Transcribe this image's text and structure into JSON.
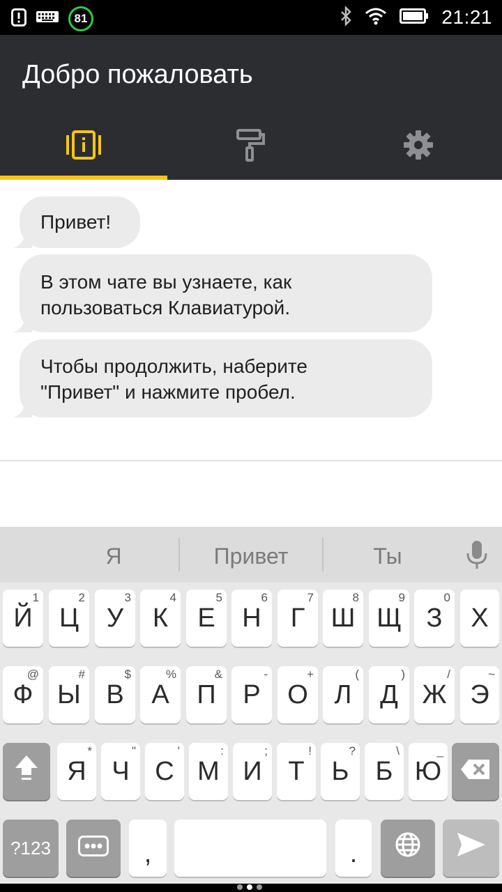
{
  "status_bar": {
    "time": "21:21",
    "badge": "81",
    "icons": [
      "alert-icon",
      "keyboard-icon",
      "bluetooth-icon",
      "wifi-icon",
      "battery-icon"
    ]
  },
  "app": {
    "title": "Добро пожаловать",
    "tabs": [
      {
        "name": "tab-info",
        "icon": "info-icon",
        "active": true
      },
      {
        "name": "tab-themes",
        "icon": "paint-roller-icon",
        "active": false
      },
      {
        "name": "tab-settings",
        "icon": "gear-icon",
        "active": false
      }
    ],
    "accent": "#f5c518"
  },
  "chat": {
    "messages": [
      {
        "line1": "Привет!",
        "line2": ""
      },
      {
        "line1": "В этом чате вы узнаете, как",
        "line2": "пользоваться Клавиатурой."
      },
      {
        "line1": "Чтобы продолжить, наберите",
        "line2": "\"Привет\" и нажмите пробел."
      }
    ]
  },
  "keyboard": {
    "suggestions": [
      "Я",
      "Привет",
      "Ты"
    ],
    "row1": [
      {
        "key": "Й",
        "hint": "1"
      },
      {
        "key": "Ц",
        "hint": "2"
      },
      {
        "key": "У",
        "hint": "3"
      },
      {
        "key": "К",
        "hint": "4"
      },
      {
        "key": "Е",
        "hint": "5"
      },
      {
        "key": "Н",
        "hint": "6"
      },
      {
        "key": "Г",
        "hint": "7"
      },
      {
        "key": "Ш",
        "hint": "8"
      },
      {
        "key": "Щ",
        "hint": "9"
      },
      {
        "key": "З",
        "hint": "0"
      },
      {
        "key": "Х",
        "hint": ""
      }
    ],
    "row2": [
      {
        "key": "Ф",
        "hint": "@"
      },
      {
        "key": "Ы",
        "hint": "#"
      },
      {
        "key": "В",
        "hint": "$"
      },
      {
        "key": "А",
        "hint": "%"
      },
      {
        "key": "П",
        "hint": "&"
      },
      {
        "key": "Р",
        "hint": "-"
      },
      {
        "key": "О",
        "hint": "+"
      },
      {
        "key": "Л",
        "hint": "("
      },
      {
        "key": "Д",
        "hint": ")"
      },
      {
        "key": "Ж",
        "hint": "/"
      },
      {
        "key": "Э",
        "hint": "~"
      }
    ],
    "row3": [
      {
        "key": "Я",
        "hint": "*"
      },
      {
        "key": "Ч",
        "hint": "\""
      },
      {
        "key": "С",
        "hint": "'"
      },
      {
        "key": "М",
        "hint": ":"
      },
      {
        "key": "И",
        "hint": ";"
      },
      {
        "key": "Т",
        "hint": "!"
      },
      {
        "key": "Ь",
        "hint": "?"
      },
      {
        "key": "Б",
        "hint": "\\"
      },
      {
        "key": "Ю",
        "hint": "_"
      }
    ],
    "symbols_label": "?123",
    "comma": ",",
    "period": "."
  }
}
